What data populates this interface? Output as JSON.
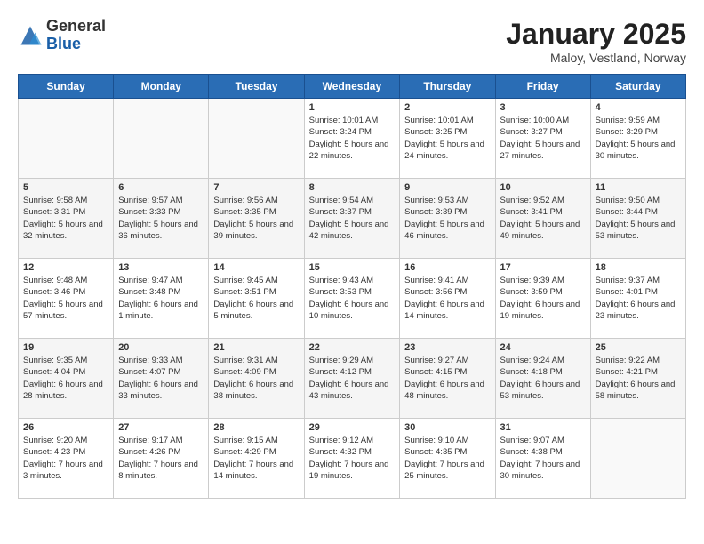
{
  "header": {
    "logo_general": "General",
    "logo_blue": "Blue",
    "title": "January 2025",
    "subtitle": "Maloy, Vestland, Norway"
  },
  "weekdays": [
    "Sunday",
    "Monday",
    "Tuesday",
    "Wednesday",
    "Thursday",
    "Friday",
    "Saturday"
  ],
  "weeks": [
    [
      {
        "day": "",
        "info": ""
      },
      {
        "day": "",
        "info": ""
      },
      {
        "day": "",
        "info": ""
      },
      {
        "day": "1",
        "info": "Sunrise: 10:01 AM\nSunset: 3:24 PM\nDaylight: 5 hours and 22 minutes."
      },
      {
        "day": "2",
        "info": "Sunrise: 10:01 AM\nSunset: 3:25 PM\nDaylight: 5 hours and 24 minutes."
      },
      {
        "day": "3",
        "info": "Sunrise: 10:00 AM\nSunset: 3:27 PM\nDaylight: 5 hours and 27 minutes."
      },
      {
        "day": "4",
        "info": "Sunrise: 9:59 AM\nSunset: 3:29 PM\nDaylight: 5 hours and 30 minutes."
      }
    ],
    [
      {
        "day": "5",
        "info": "Sunrise: 9:58 AM\nSunset: 3:31 PM\nDaylight: 5 hours and 32 minutes."
      },
      {
        "day": "6",
        "info": "Sunrise: 9:57 AM\nSunset: 3:33 PM\nDaylight: 5 hours and 36 minutes."
      },
      {
        "day": "7",
        "info": "Sunrise: 9:56 AM\nSunset: 3:35 PM\nDaylight: 5 hours and 39 minutes."
      },
      {
        "day": "8",
        "info": "Sunrise: 9:54 AM\nSunset: 3:37 PM\nDaylight: 5 hours and 42 minutes."
      },
      {
        "day": "9",
        "info": "Sunrise: 9:53 AM\nSunset: 3:39 PM\nDaylight: 5 hours and 46 minutes."
      },
      {
        "day": "10",
        "info": "Sunrise: 9:52 AM\nSunset: 3:41 PM\nDaylight: 5 hours and 49 minutes."
      },
      {
        "day": "11",
        "info": "Sunrise: 9:50 AM\nSunset: 3:44 PM\nDaylight: 5 hours and 53 minutes."
      }
    ],
    [
      {
        "day": "12",
        "info": "Sunrise: 9:48 AM\nSunset: 3:46 PM\nDaylight: 5 hours and 57 minutes."
      },
      {
        "day": "13",
        "info": "Sunrise: 9:47 AM\nSunset: 3:48 PM\nDaylight: 6 hours and 1 minute."
      },
      {
        "day": "14",
        "info": "Sunrise: 9:45 AM\nSunset: 3:51 PM\nDaylight: 6 hours and 5 minutes."
      },
      {
        "day": "15",
        "info": "Sunrise: 9:43 AM\nSunset: 3:53 PM\nDaylight: 6 hours and 10 minutes."
      },
      {
        "day": "16",
        "info": "Sunrise: 9:41 AM\nSunset: 3:56 PM\nDaylight: 6 hours and 14 minutes."
      },
      {
        "day": "17",
        "info": "Sunrise: 9:39 AM\nSunset: 3:59 PM\nDaylight: 6 hours and 19 minutes."
      },
      {
        "day": "18",
        "info": "Sunrise: 9:37 AM\nSunset: 4:01 PM\nDaylight: 6 hours and 23 minutes."
      }
    ],
    [
      {
        "day": "19",
        "info": "Sunrise: 9:35 AM\nSunset: 4:04 PM\nDaylight: 6 hours and 28 minutes."
      },
      {
        "day": "20",
        "info": "Sunrise: 9:33 AM\nSunset: 4:07 PM\nDaylight: 6 hours and 33 minutes."
      },
      {
        "day": "21",
        "info": "Sunrise: 9:31 AM\nSunset: 4:09 PM\nDaylight: 6 hours and 38 minutes."
      },
      {
        "day": "22",
        "info": "Sunrise: 9:29 AM\nSunset: 4:12 PM\nDaylight: 6 hours and 43 minutes."
      },
      {
        "day": "23",
        "info": "Sunrise: 9:27 AM\nSunset: 4:15 PM\nDaylight: 6 hours and 48 minutes."
      },
      {
        "day": "24",
        "info": "Sunrise: 9:24 AM\nSunset: 4:18 PM\nDaylight: 6 hours and 53 minutes."
      },
      {
        "day": "25",
        "info": "Sunrise: 9:22 AM\nSunset: 4:21 PM\nDaylight: 6 hours and 58 minutes."
      }
    ],
    [
      {
        "day": "26",
        "info": "Sunrise: 9:20 AM\nSunset: 4:23 PM\nDaylight: 7 hours and 3 minutes."
      },
      {
        "day": "27",
        "info": "Sunrise: 9:17 AM\nSunset: 4:26 PM\nDaylight: 7 hours and 8 minutes."
      },
      {
        "day": "28",
        "info": "Sunrise: 9:15 AM\nSunset: 4:29 PM\nDaylight: 7 hours and 14 minutes."
      },
      {
        "day": "29",
        "info": "Sunrise: 9:12 AM\nSunset: 4:32 PM\nDaylight: 7 hours and 19 minutes."
      },
      {
        "day": "30",
        "info": "Sunrise: 9:10 AM\nSunset: 4:35 PM\nDaylight: 7 hours and 25 minutes."
      },
      {
        "day": "31",
        "info": "Sunrise: 9:07 AM\nSunset: 4:38 PM\nDaylight: 7 hours and 30 minutes."
      },
      {
        "day": "",
        "info": ""
      }
    ]
  ]
}
